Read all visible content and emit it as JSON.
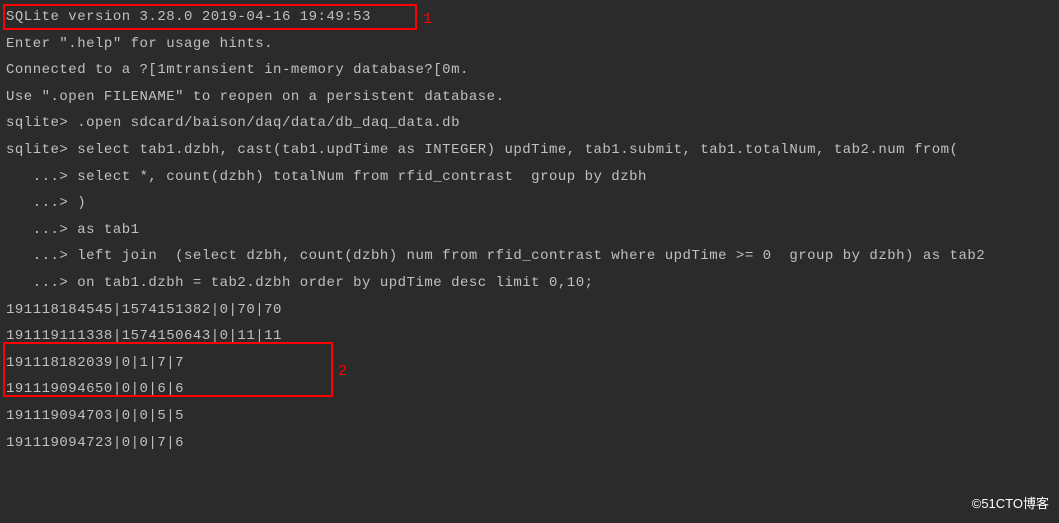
{
  "terminal": {
    "lines": [
      "SQLite version 3.28.0 2019-04-16 19:49:53",
      "Enter \".help\" for usage hints.",
      "Connected to a ?[1mtransient in-memory database?[0m.",
      "Use \".open FILENAME\" to reopen on a persistent database.",
      "sqlite> .open sdcard/baison/daq/data/db_daq_data.db",
      "sqlite> select tab1.dzbh, cast(tab1.updTime as INTEGER) updTime, tab1.submit, tab1.totalNum, tab2.num from(",
      "   ...> select *, count(dzbh) totalNum from rfid_contrast  group by dzbh",
      "   ...> )",
      "   ...> as tab1",
      "   ...> left join  (select dzbh, count(dzbh) num from rfid_contrast where updTime >= 0  group by dzbh) as tab2",
      "   ...> on tab1.dzbh = tab2.dzbh order by updTime desc limit 0,10;",
      "191118184545|1574151382|0|70|70",
      "191119111338|1574150643|0|11|11",
      "191118182039|0|1|7|7",
      "191119094650|0|0|6|6",
      "191119094703|0|0|5|5",
      "191119094723|0|0|7|6"
    ]
  },
  "annotations": {
    "ann1": "1",
    "ann2": "2"
  },
  "watermark": "©51CTO博客"
}
